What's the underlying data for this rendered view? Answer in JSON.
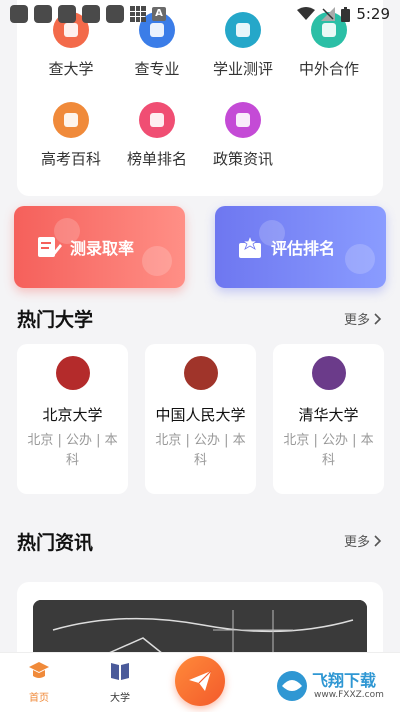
{
  "status_bar": {
    "time": "5:29"
  },
  "categories": [
    {
      "label": "查大学",
      "color": "#f36a4a",
      "icon": "university-icon"
    },
    {
      "label": "查专业",
      "color": "#3b7de8",
      "icon": "book-icon"
    },
    {
      "label": "学业测评",
      "color": "#25a7c9",
      "icon": "graduation-cap-icon"
    },
    {
      "label": "中外合作",
      "color": "#2bbfa6",
      "icon": "heart-icon"
    },
    {
      "label": "高考百科",
      "color": "#f08a3a",
      "icon": "shield-icon"
    },
    {
      "label": "榜单排名",
      "color": "#f04e73",
      "icon": "bar-chart-icon"
    },
    {
      "label": "政策资讯",
      "color": "#c44bd6",
      "icon": "document-icon"
    }
  ],
  "banners": [
    {
      "label": "测录取率"
    },
    {
      "label": "评估排名"
    }
  ],
  "hot_universities": {
    "title": "热门大学",
    "more": "更多",
    "items": [
      {
        "name": "北京大学",
        "meta": "北京 | 公办 | 本科",
        "color": "#b42b2b"
      },
      {
        "name": "中国人民大学",
        "meta": "北京 | 公办 | 本科",
        "color": "#a0342a"
      },
      {
        "name": "清华大学",
        "meta": "北京 | 公办 | 本科",
        "color": "#6b3b8a"
      }
    ]
  },
  "hot_news": {
    "title": "热门资讯",
    "more": "更多"
  },
  "bottom_nav": [
    {
      "label": "首页",
      "active": true
    },
    {
      "label": "大学",
      "active": false
    }
  ],
  "watermark": {
    "text": "飞翔下载",
    "url": "www.FXXZ.com"
  }
}
